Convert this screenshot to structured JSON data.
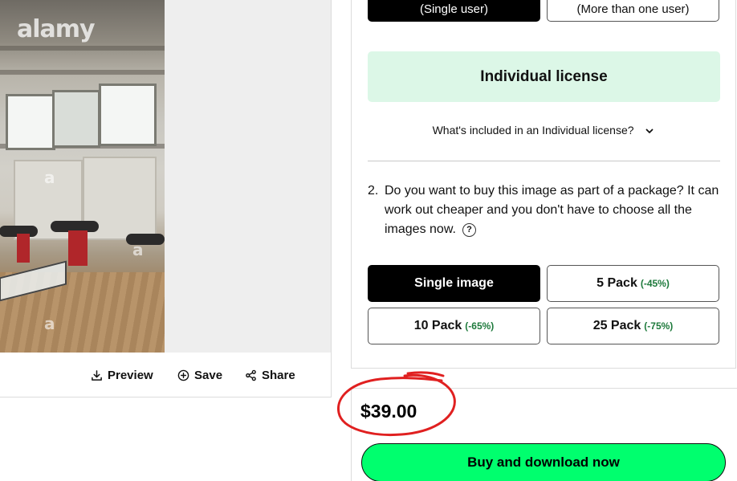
{
  "image_panel": {
    "watermark": "alamy",
    "watermark_mark": "a",
    "actions": {
      "preview_label": "Preview",
      "save_label": "Save",
      "share_label": "Share"
    }
  },
  "license": {
    "user_options": {
      "single": "(Single user)",
      "multi": "(More than one user)"
    },
    "selected_license": "Individual license",
    "included_link": "What's included in an Individual license?",
    "package_question": {
      "number": "2.",
      "text": "Do you want to buy this image as part of a package? It can work out cheaper and you don't have to choose all the images now."
    },
    "packs": [
      {
        "label": "Single image",
        "discount": ""
      },
      {
        "label": "5 Pack",
        "discount": "(-45%)"
      },
      {
        "label": "10 Pack",
        "discount": "(-65%)"
      },
      {
        "label": "25 Pack",
        "discount": "(-75%)"
      }
    ]
  },
  "checkout": {
    "price": "$39.00",
    "buy_label": "Buy and download now"
  },
  "colors": {
    "license_banner_bg": "#dcf7e7",
    "buy_button_bg": "#00ff6e",
    "discount_text": "#1e7a3c",
    "annotation_circle": "#e02020"
  },
  "icons": {
    "preview": "download-icon",
    "save": "plus-circle-icon",
    "share": "share-icon",
    "expand": "chevron-down-icon",
    "help": "question-circle-icon"
  }
}
